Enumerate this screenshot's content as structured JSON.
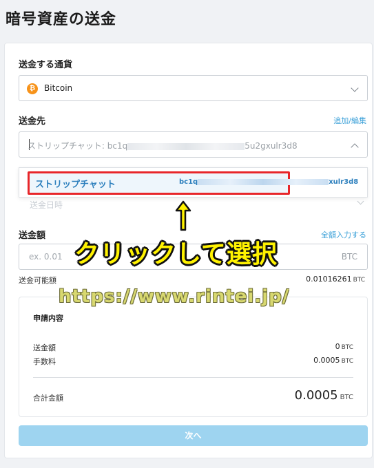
{
  "page": {
    "title": "暗号資産の送金"
  },
  "currency": {
    "label": "送金する通貨",
    "selected": "Bitcoin",
    "icon": "bitcoin-icon",
    "icon_glyph": "₿",
    "icon_color": "#f7931a"
  },
  "destination": {
    "label": "送金先",
    "edit_link": "追加/編集",
    "value_prefix": "ストリップチャット: bc1q",
    "value_suffix": "5u2gxulr3d8"
  },
  "dropdown": {
    "option_name": "ストリップチャット",
    "option_addr_prefix": "bc1q",
    "option_addr_suffix": "xulr3d8"
  },
  "send_date": {
    "label": "送金日時"
  },
  "amount": {
    "label": "送金額",
    "full_amount_link": "全額入力する",
    "placeholder": "ex. 0.01",
    "unit": "BTC"
  },
  "available": {
    "label": "送金可能額",
    "value": "0.01016261",
    "unit": "BTC"
  },
  "summary": {
    "title": "申請内容",
    "send_amount_label": "送金額",
    "send_amount_value": "0",
    "send_amount_unit": "BTC",
    "fee_label": "手数料",
    "fee_value": "0.0005",
    "fee_unit": "BTC",
    "total_label": "合計金額",
    "total_value": "0.0005",
    "total_unit": "BTC"
  },
  "next_button": "次へ",
  "overlay": {
    "instruction": "クリックして選択",
    "watermark": "https://www.rintei.jp/"
  },
  "colors": {
    "accent": "#3aa0d8",
    "highlight_border": "#e8262a",
    "button": "#9ed4f0",
    "overlay_text": "#fff200"
  }
}
